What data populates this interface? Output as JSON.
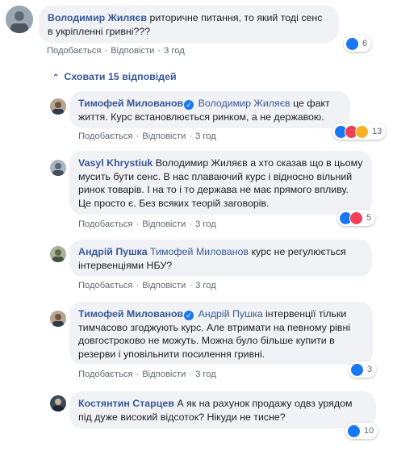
{
  "top_comment": {
    "author": "Володимир Жиляєв",
    "text": "риторичне питання, то який тоді сенс в укріпленні гривні???",
    "like": "Подобається",
    "reply": "Відповісти",
    "time": "3 год",
    "reactions": "6"
  },
  "hide_replies": "Сховати 15 відповідей",
  "replies": [
    {
      "author": "Тимофей Милованов",
      "verified": true,
      "mention": "Володимир Жиляєв",
      "text": "це факт життя. Курс встановлюється ринком, а не державою.",
      "like": "Подобається",
      "reply": "Відповісти",
      "time": "3 год",
      "reactions": "13"
    },
    {
      "author": "Vasyl Khrystiuk",
      "verified": false,
      "mention": "Володимир Жиляєв",
      "text": "а хто сказав що в цьому мусить бути сенс. В нас плаваючий курс і відносно вільний ринок товарів. І на то і то держава не має прямого впливу. Це просто є. Без всяких теорій заговорів.",
      "like": "Подобається",
      "reply": "Відповісти",
      "time": "3 год",
      "reactions": "5"
    },
    {
      "author": "Андрій Пушка",
      "verified": false,
      "mention": "Тимофей Милованов",
      "text": "курс не регулюється інтервенціями НБУ?",
      "like": "Подобається",
      "reply": "Відповісти",
      "time": "3 год",
      "reactions": ""
    },
    {
      "author": "Тимофей Милованов",
      "verified": true,
      "mention": "Андрій Пушка",
      "text": "інтервенції тільки тимчасово згоджують курс. Але втримати на певному рівні довгостроково не можуть. Можна було більше купити в резерви і уповільнити посилення гривні.",
      "like": "Подобається",
      "reply": "Відповісти",
      "time": "3 год",
      "reactions": "3"
    },
    {
      "author": "Костянтин Старцев",
      "verified": false,
      "mention": "",
      "text": "А як на рахунок продажу одвз урядом під дуже високий відсоток? Нікуди не тисне?",
      "like": "",
      "reply": "",
      "time": "",
      "reactions": "10"
    }
  ]
}
